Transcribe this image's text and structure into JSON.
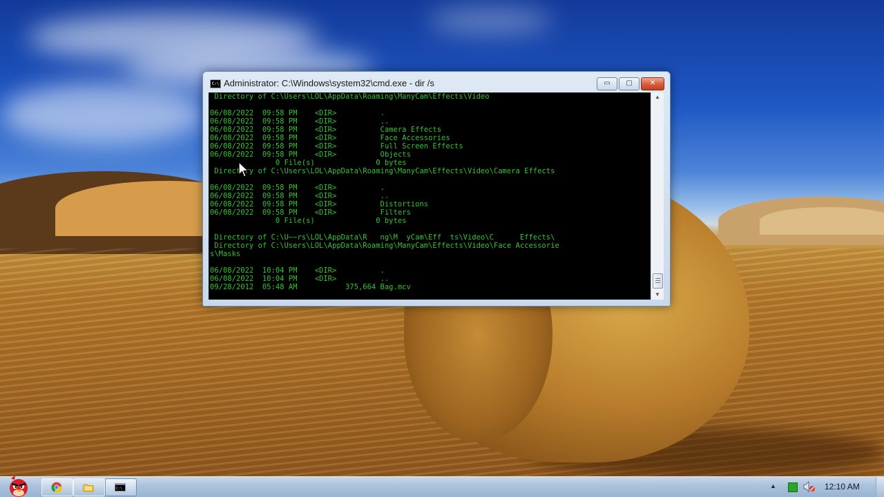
{
  "window": {
    "title": "Administrator: C:\\Windows\\system32\\cmd.exe - dir /s",
    "controls": {
      "minimize": "▭",
      "maximize": "▢",
      "close": "✕"
    },
    "icon_label": "C:\\"
  },
  "console": {
    "lines": [
      " Directory of C:\\Users\\LOL\\AppData\\Roaming\\ManyCam\\Effects\\Video",
      "",
      "06/08/2022  09:58 PM    <DIR>          .",
      "06/08/2022  09:58 PM    <DIR>          ..",
      "06/08/2022  09:58 PM    <DIR>          Camera Effects",
      "06/08/2022  09:58 PM    <DIR>          Face Accessories",
      "06/08/2022  09:58 PM    <DIR>          Full Screen Effects",
      "06/08/2022  09:58 PM    <DIR>          Objects",
      "               0 File(s)              0 bytes",
      " Directory of C:\\Users\\LOL\\AppData\\Roaming\\ManyCam\\Effects\\Video\\Camera Effects",
      "",
      "06/08/2022  09:58 PM    <DIR>          .",
      "06/08/2022  09:58 PM    <DIR>          ..",
      "06/08/2022  09:58 PM    <DIR>          Distortions",
      "06/08/2022  09:58 PM    <DIR>          Filters",
      "               0 File(s)              0 bytes",
      "",
      " Directory of C:\\U~~rs\\LOL\\AppData\\R   ng\\M  yCam\\Eff  ts\\Video\\C      Effects\\",
      " Directory of C:\\Users\\LOL\\AppData\\Roaming\\ManyCam\\Effects\\Video\\Face Accessorie",
      "s\\Masks",
      "",
      "06/08/2022  10:04 PM    <DIR>          .",
      "06/08/2022  10:04 PM    <DIR>          ..",
      "09/28/2012  05:48 AM           375,664 Bag.mcv"
    ]
  },
  "scrollbar": {
    "up": "▲",
    "down": "▼"
  },
  "taskbar": {
    "apps": [
      {
        "name": "Google Chrome",
        "icon": "chrome-icon"
      },
      {
        "name": "Windows Explorer",
        "icon": "folder-icon"
      },
      {
        "name": "Command Prompt",
        "icon": "cmd-icon",
        "active": true
      }
    ],
    "tray_arrow": "▲",
    "clock": "12:10 AM"
  },
  "colors": {
    "console_text": "#2dc52d",
    "console_bg": "#000000",
    "close_button": "#c9482a"
  }
}
